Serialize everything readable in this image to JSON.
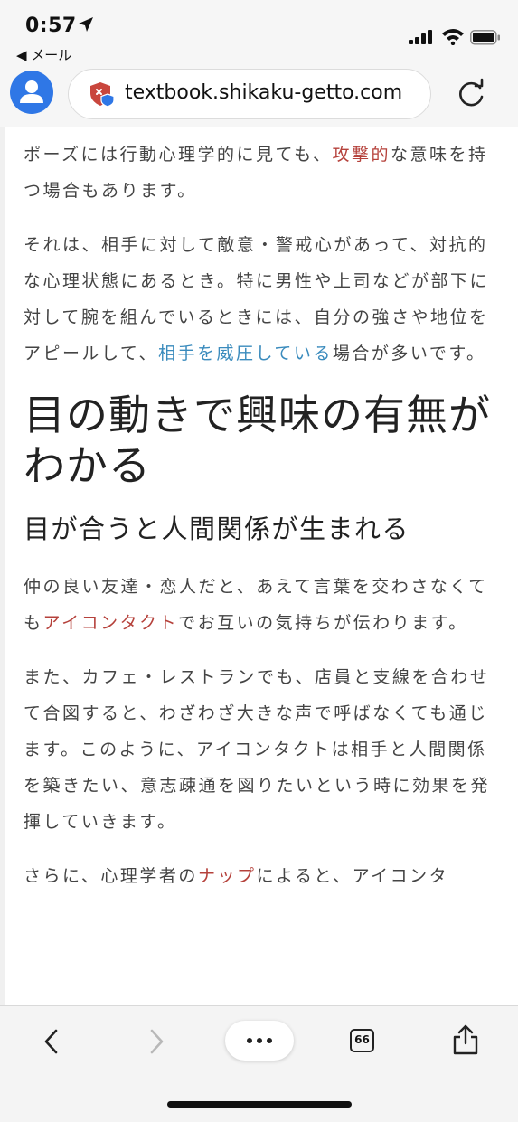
{
  "status_bar": {
    "time": "0:57",
    "back_app": "◀ メール"
  },
  "browser": {
    "url": "textbook.shikaku-getto.com"
  },
  "article": {
    "p1_a": "ポーズには行動心理学的に見ても、",
    "p1_link": "攻撃的",
    "p1_b": "な意味を持つ場合もあります。",
    "p2_a": "それは、相手に対して敵意・警戒心があって、対抗的な心理状態にあるとき。特に男性や上司などが部下に対して腕を組んでいるときには、自分の強さや地位をアピールして、",
    "p2_link": "相手を威圧している",
    "p2_b": "場合が多いです。",
    "h2": "目の動きで興味の有無がわかる",
    "h3": "目が合うと人間関係が生まれる",
    "p3_a": "仲の良い友達・恋人だと、あえて言葉を交わさなくても",
    "p3_link": "アイコンタクト",
    "p3_b": "でお互いの気持ちが伝わります。",
    "p4": "また、カフェ・レストランでも、店員と支線を合わせて合図すると、わざわざ大きな声で呼ばなくても通じます。このように、アイコンタクトは相手と人間関係を築きたい、意志疎通を図りたいという時に効果を発揮していきます。",
    "p5_a": "さらに、心理学者の",
    "p5_link": "ナップ",
    "p5_b": "によると、アイコンタ"
  },
  "toolbar": {
    "tabs_count": "66"
  },
  "colors": {
    "link_red": "#b5413b",
    "link_blue": "#3a8bbd",
    "avatar_blue": "#2f77e6",
    "shield_red": "#c9463d",
    "shield_blue": "#2f77e6"
  },
  "icons": [
    "location-arrow-icon",
    "signal-icon",
    "wifi-icon",
    "battery-icon",
    "avatar-icon",
    "shield-icon",
    "reload-icon",
    "chevron-left-icon",
    "chevron-right-icon",
    "more-icon",
    "tabs-icon",
    "share-icon"
  ]
}
